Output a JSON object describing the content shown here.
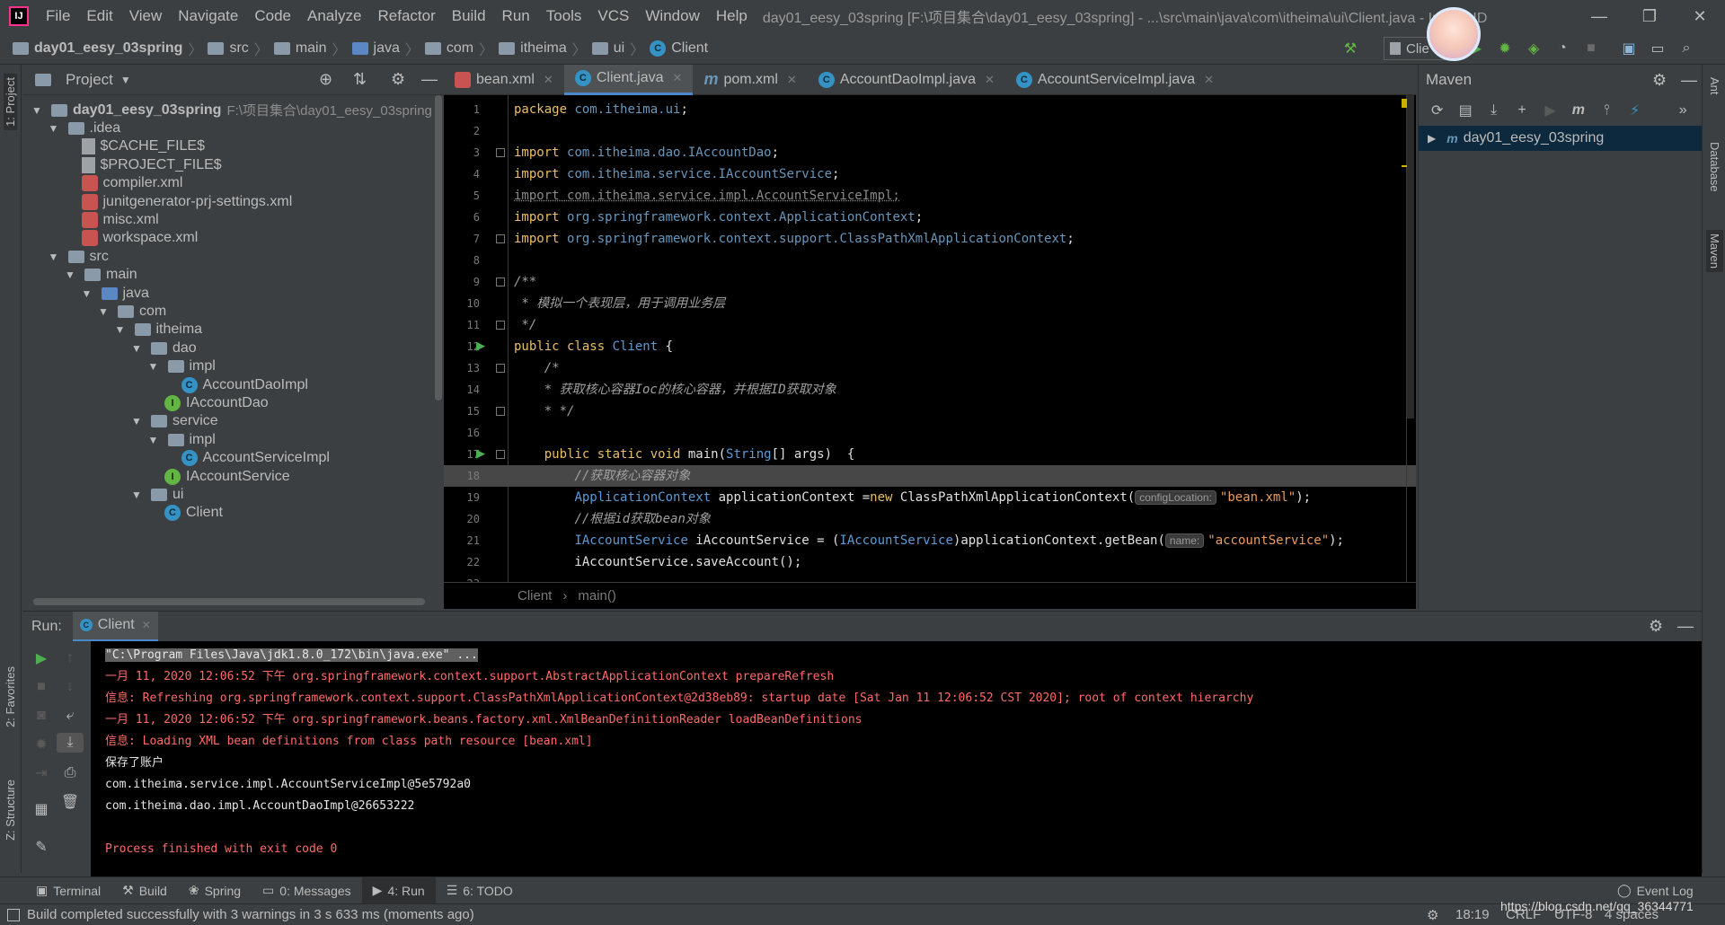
{
  "menubar": {
    "items": [
      "File",
      "Edit",
      "View",
      "Navigate",
      "Code",
      "Analyze",
      "Refactor",
      "Build",
      "Run",
      "Tools",
      "VCS",
      "Window",
      "Help"
    ],
    "window_title": "day01_eesy_03spring [F:\\项目集合\\day01_eesy_03spring] - ...\\src\\main\\java\\com\\itheima\\ui\\Client.java - IntelliJ ID",
    "run_config": "Clie"
  },
  "navbar": {
    "crumbs": [
      "day01_eesy_03spring",
      "src",
      "main",
      "java",
      "com",
      "itheima",
      "ui",
      "Client"
    ]
  },
  "project": {
    "title": "Project",
    "tree": [
      {
        "label": "day01_eesy_03spring",
        "path": "F:\\项目集合\\day01_eesy_03spring",
        "indent": 0,
        "arrow": "▼",
        "icon": "module"
      },
      {
        "label": ".idea",
        "indent": 1,
        "arrow": "▼",
        "icon": "folder"
      },
      {
        "label": "$CACHE_FILE$",
        "indent": 3,
        "arrow": "",
        "icon": "file"
      },
      {
        "label": "$PROJECT_FILE$",
        "indent": 3,
        "arrow": "",
        "icon": "file"
      },
      {
        "label": "compiler.xml",
        "indent": 3,
        "arrow": "",
        "icon": "xml"
      },
      {
        "label": "junitgenerator-prj-settings.xml",
        "indent": 3,
        "arrow": "",
        "icon": "xml"
      },
      {
        "label": "misc.xml",
        "indent": 3,
        "arrow": "",
        "icon": "xml"
      },
      {
        "label": "workspace.xml",
        "indent": 3,
        "arrow": "",
        "icon": "xml"
      },
      {
        "label": "src",
        "indent": 1,
        "arrow": "▼",
        "icon": "folder"
      },
      {
        "label": "main",
        "indent": 2,
        "arrow": "▼",
        "icon": "folder"
      },
      {
        "label": "java",
        "indent": 3,
        "arrow": "▼",
        "icon": "folder-blue"
      },
      {
        "label": "com",
        "indent": 4,
        "arrow": "▼",
        "icon": "package"
      },
      {
        "label": "itheima",
        "indent": 5,
        "arrow": "▼",
        "icon": "package"
      },
      {
        "label": "dao",
        "indent": 6,
        "arrow": "▼",
        "icon": "package"
      },
      {
        "label": "impl",
        "indent": 7,
        "arrow": "▼",
        "icon": "package"
      },
      {
        "label": "AccountDaoImpl",
        "indent": 9,
        "arrow": "",
        "icon": "class"
      },
      {
        "label": "IAccountDao",
        "indent": 8,
        "arrow": "",
        "icon": "interface"
      },
      {
        "label": "service",
        "indent": 6,
        "arrow": "▼",
        "icon": "package"
      },
      {
        "label": "impl",
        "indent": 7,
        "arrow": "▼",
        "icon": "package"
      },
      {
        "label": "AccountServiceImpl",
        "indent": 9,
        "arrow": "",
        "icon": "class"
      },
      {
        "label": "IAccountService",
        "indent": 8,
        "arrow": "",
        "icon": "interface"
      },
      {
        "label": "ui",
        "indent": 6,
        "arrow": "▼",
        "icon": "package"
      },
      {
        "label": "Client",
        "indent": 8,
        "arrow": "",
        "icon": "class"
      }
    ]
  },
  "editor": {
    "tabs": [
      {
        "label": "bean.xml",
        "icon": "xml",
        "active": false
      },
      {
        "label": "Client.java",
        "icon": "class",
        "active": true
      },
      {
        "label": "pom.xml",
        "icon": "maven",
        "active": false
      },
      {
        "label": "AccountDaoImpl.java",
        "icon": "class",
        "active": false
      },
      {
        "label": "AccountServiceImpl.java",
        "icon": "class",
        "active": false
      }
    ],
    "current_line": 18,
    "lines": [
      {
        "n": "1",
        "html": "<span class='kw'>package</span> <span class='pkg'>com.itheima.ui</span>;"
      },
      {
        "n": "2",
        "html": ""
      },
      {
        "n": "3",
        "html": "<span class='kw'>import</span> <span class='pkg'>com.itheima.dao.IAccountDao</span>;"
      },
      {
        "n": "4",
        "html": "<span class='kw'>import</span> <span class='pkg'>com.itheima.service.IAccountService</span>;"
      },
      {
        "n": "5",
        "html": "<span style='color:#8a8a8a;text-decoration:underline dotted'>import com.itheima.service.impl.AccountServiceImpl;</span>"
      },
      {
        "n": "6",
        "html": "<span class='kw'>import</span> <span class='pkg'>org.springframework.context.ApplicationContext</span>;"
      },
      {
        "n": "7",
        "html": "<span class='kw'>import</span> <span class='pkg'>org.springframework.context.support.ClassPathXmlApplicationContext</span>;"
      },
      {
        "n": "8",
        "html": ""
      },
      {
        "n": "9",
        "html": "<span class='cmt'>/**</span>"
      },
      {
        "n": "10",
        "html": "<span class='cmt'> * 模拟一个表现层，用于调用业务层</span>"
      },
      {
        "n": "11",
        "html": "<span class='cmt'> */</span>"
      },
      {
        "n": "12",
        "html": "<span class='kw'>public class</span> <span class='typ'>Client</span> {"
      },
      {
        "n": "13",
        "html": "    <span class='cmt'>/*</span>"
      },
      {
        "n": "14",
        "html": "    <span class='cmt'>* 获取核心容器Ioc的核心容器，并根据ID获取对象</span>"
      },
      {
        "n": "15",
        "html": "    <span class='cmt'>* */</span>"
      },
      {
        "n": "16",
        "html": ""
      },
      {
        "n": "17",
        "html": "    <span class='kw'>public static void</span> main(<span class='typ'>String</span>[] args)  {"
      },
      {
        "n": "18",
        "html": "        <span class='cmt'>//获取核心容器对象</span>"
      },
      {
        "n": "19",
        "html": "        <span class='typ'>ApplicationContext</span> applicationContext =<span class='kw'>new</span> ClassPathXmlApplicationContext(<span class='hint'>configLocation:</span><span class='str'>\"bean.xml\"</span>);"
      },
      {
        "n": "20",
        "html": "        <span class='cmt'>//根据id获取bean对象</span>"
      },
      {
        "n": "21",
        "html": "        <span class='typ'>IAccountService</span> iAccountService = (<span class='typ'>IAccountService</span>)applicationContext.getBean(<span class='hint'>name:</span><span class='str'>\"accountService\"</span>);"
      },
      {
        "n": "22",
        "html": "        iAccountService.saveAccount();"
      },
      {
        "n": "23",
        "html": ""
      }
    ],
    "breadcrumb": [
      "Client",
      "main()"
    ]
  },
  "maven": {
    "title": "Maven",
    "project": "day01_eesy_03spring"
  },
  "run": {
    "label": "Run:",
    "tab": "Client",
    "lines": [
      {
        "cls": "gray-sel",
        "text": "\"C:\\Program Files\\Java\\jdk1.8.0_172\\bin\\java.exe\" ..."
      },
      {
        "cls": "red",
        "text": "一月 11, 2020 12:06:52 下午 org.springframework.context.support.AbstractApplicationContext prepareRefresh"
      },
      {
        "cls": "red",
        "text": "信息: Refreshing org.springframework.context.support.ClassPathXmlApplicationContext@2d38eb89: startup date [Sat Jan 11 12:06:52 CST 2020]; root of context hierarchy"
      },
      {
        "cls": "red",
        "text": "一月 11, 2020 12:06:52 下午 org.springframework.beans.factory.xml.XmlBeanDefinitionReader loadBeanDefinitions"
      },
      {
        "cls": "red",
        "text": "信息: Loading XML bean definitions from class path resource [bean.xml]"
      },
      {
        "cls": "white",
        "text": "保存了账户"
      },
      {
        "cls": "white",
        "text": "com.itheima.service.impl.AccountServiceImpl@5e5792a0"
      },
      {
        "cls": "white",
        "text": "com.itheima.dao.impl.AccountDaoImpl@26653222"
      },
      {
        "cls": "white",
        "text": ""
      },
      {
        "cls": "red",
        "text": "Process finished with exit code 0"
      }
    ]
  },
  "bottombar": {
    "tabs": [
      "Terminal",
      "Build",
      "Spring",
      "0: Messages",
      "4: Run",
      "6: TODO"
    ],
    "event_log": "Event Log"
  },
  "status": {
    "message": "Build completed successfully with 3 warnings in 3 s 633 ms (moments ago)",
    "time": "18:19",
    "crlf": "CRLF",
    "encoding": "UTF-8",
    "indent": "4 spaces",
    "watermark": "https://blog.csdn.net/qq_36344771"
  },
  "stripes": {
    "left_top": "1: Project",
    "left_fav": "2: Favorites",
    "left_struct": "Z: Structure",
    "right_ant": "Ant",
    "right_db": "Database",
    "right_maven": "Maven"
  }
}
